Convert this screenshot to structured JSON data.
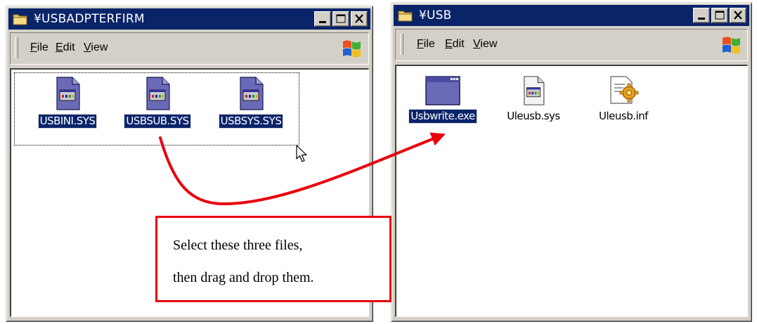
{
  "left_window": {
    "title": "¥USBADPTERFIRM",
    "menu": [
      "File",
      "Edit",
      "View"
    ],
    "files": [
      {
        "name": "USBINI.SYS",
        "icon": "sys-file-icon",
        "selected": true
      },
      {
        "name": "USBSUB.SYS",
        "icon": "sys-file-icon",
        "selected": true
      },
      {
        "name": "USBSYS.SYS",
        "icon": "sys-file-icon",
        "selected": true
      }
    ]
  },
  "right_window": {
    "title": "¥USB",
    "menu": [
      "File",
      "Edit",
      "View"
    ],
    "files": [
      {
        "name": "Usbwrite.exe",
        "icon": "exe-file-icon",
        "selected": true
      },
      {
        "name": "Uleusb.sys",
        "icon": "sys-file-icon",
        "selected": false
      },
      {
        "name": "Uleusb.inf",
        "icon": "inf-file-icon",
        "selected": false
      }
    ]
  },
  "callout": {
    "line1": "Select these three files,",
    "line2": "then drag and drop them."
  },
  "colors": {
    "titlebar": "#0a246a",
    "selection": "#0a246a",
    "arrow": "#e8000d",
    "face": "#d4d0c8"
  }
}
